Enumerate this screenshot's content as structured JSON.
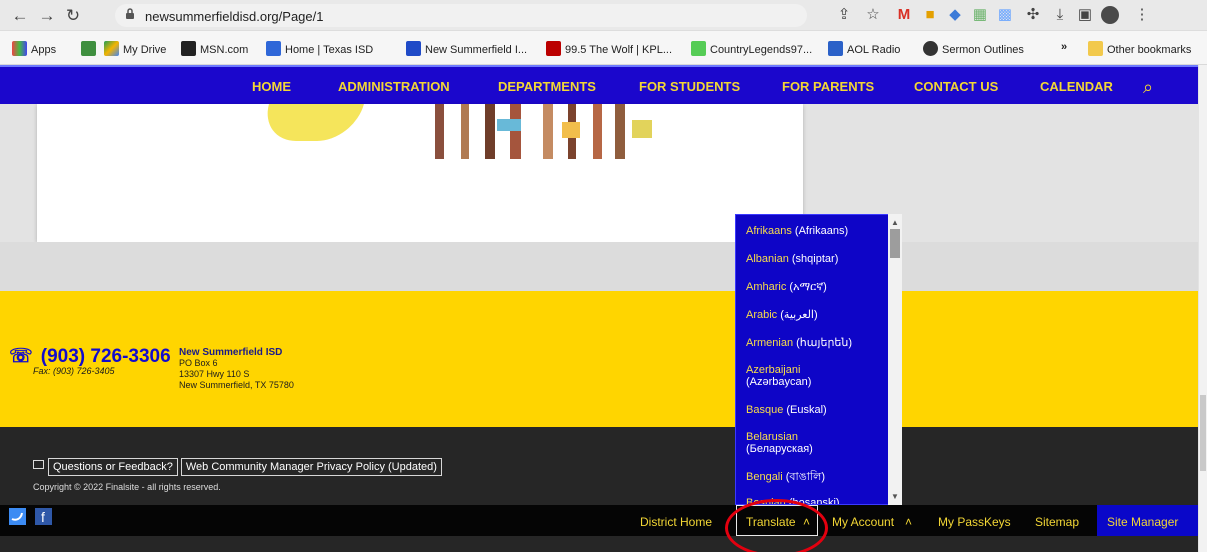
{
  "browser": {
    "url": "newsummerfieldisd.org/Page/1",
    "bookmarks": {
      "apps": "Apps",
      "my_drive": "My Drive",
      "msn": "MSN.com",
      "home_texas": "Home | Texas ISD",
      "new_summerfield": "New Summerfield I...",
      "wolf": "99.5 The Wolf | KPL...",
      "country": "CountryLegends97...",
      "aol": "AOL Radio",
      "sermon": "Sermon Outlines",
      "overflow": "»",
      "other": "Other bookmarks"
    }
  },
  "nav": {
    "items": [
      "HOME",
      "ADMINISTRATION",
      "DEPARTMENTS",
      "FOR STUDENTS",
      "FOR PARENTS",
      "CONTACT US",
      "CALENDAR"
    ]
  },
  "footer": {
    "phone": "(903) 726-3306",
    "fax": "Fax: (903) 726-3405",
    "district_name": "New Summerfield ISD",
    "po_box": "PO Box 6",
    "address": "13307 Hwy 110 S",
    "city": "New Summerfield, TX 75780",
    "feedback": "Questions or Feedback?",
    "privacy": "Web Community Manager Privacy Policy (Updated)",
    "copyright": "Copyright © 2022 Finalsite - all rights reserved."
  },
  "bottom_links": {
    "district_home": "District Home",
    "translate": "Translate",
    "my_account": "My Account",
    "my_passkeys": "My PassKeys",
    "sitemap": "Sitemap",
    "site_manager": "Site Manager"
  },
  "translate_menu": {
    "languages": [
      {
        "name": "Afrikaans",
        "native": "(Afrikaans)"
      },
      {
        "name": "Albanian",
        "native": "(shqiptar)"
      },
      {
        "name": "Amharic",
        "native": "(አማርኛ)"
      },
      {
        "name": "Arabic",
        "native": "(العربية)"
      },
      {
        "name": "Armenian",
        "native": "(հայերեն)"
      },
      {
        "name": "Azerbaijani",
        "native": "(Azərbaycan)"
      },
      {
        "name": "Basque",
        "native": "(Euskal)"
      },
      {
        "name": "Belarusian",
        "native": "(Беларуская)"
      },
      {
        "name": "Bengali",
        "native": "(বাঙালি)"
      },
      {
        "name": "Bosnian",
        "native": "(bosanski)"
      }
    ]
  },
  "colors": {
    "nav_blue": "#1b07cc",
    "accent_yellow": "#f3d735",
    "footer_yellow": "#ffd500",
    "footer_dark": "#262626",
    "red_circle": "#e3000f"
  }
}
